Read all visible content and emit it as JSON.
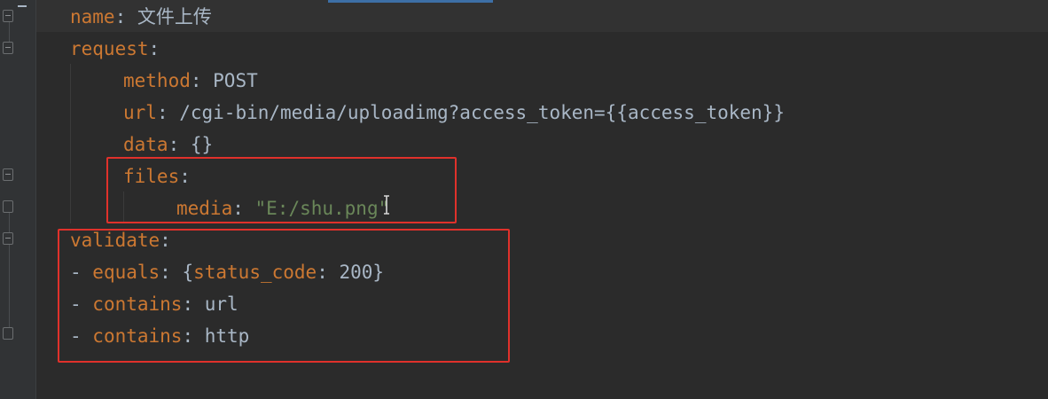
{
  "editor": {
    "lines": [
      {
        "indent": 0,
        "dash": "",
        "key": "name",
        "sep": ": ",
        "value": "文件上传",
        "value_kind": "plain"
      },
      {
        "indent": 0,
        "dash": "",
        "key": "request",
        "sep": ":",
        "value": "",
        "value_kind": "plain"
      },
      {
        "indent": 2,
        "dash": "",
        "key": "method",
        "sep": ": ",
        "value": "POST",
        "value_kind": "plain"
      },
      {
        "indent": 2,
        "dash": "",
        "key": "url",
        "sep": ": ",
        "value": "/cgi-bin/media/uploadimg?access_token={{access_token}}",
        "value_kind": "plain"
      },
      {
        "indent": 2,
        "dash": "",
        "key": "data",
        "sep": ": ",
        "value": "{}",
        "value_kind": "plain"
      },
      {
        "indent": 2,
        "dash": "",
        "key": "files",
        "sep": ":",
        "value": "",
        "value_kind": "plain"
      },
      {
        "indent": 4,
        "dash": "",
        "key": "media",
        "sep": ": ",
        "value": "\"E:/shu.png\"",
        "value_kind": "string"
      },
      {
        "indent": 0,
        "dash": "",
        "key": "validate",
        "sep": ":",
        "value": "",
        "value_kind": "plain"
      },
      {
        "indent": 0,
        "dash": "- ",
        "key": "equals",
        "sep": ": ",
        "value": "{status_code: 200}",
        "value_kind": "map"
      },
      {
        "indent": 0,
        "dash": "- ",
        "key": "contains",
        "sep": ": ",
        "value": "url",
        "value_kind": "plain"
      },
      {
        "indent": 0,
        "dash": "- ",
        "key": "contains",
        "sep": ": ",
        "value": "http",
        "value_kind": "plain"
      }
    ],
    "map_parts": {
      "open": "{",
      "key": "status_code",
      "sep": ": ",
      "value": "200",
      "close": "}"
    }
  },
  "colors": {
    "background": "#2b2b2b",
    "key": "#cc7832",
    "text": "#a9b7c6",
    "string": "#6a8759",
    "annotation": "#e0312b"
  },
  "icons": [
    "fold-marker-icon",
    "fold-end-icon",
    "text-cursor-icon"
  ]
}
